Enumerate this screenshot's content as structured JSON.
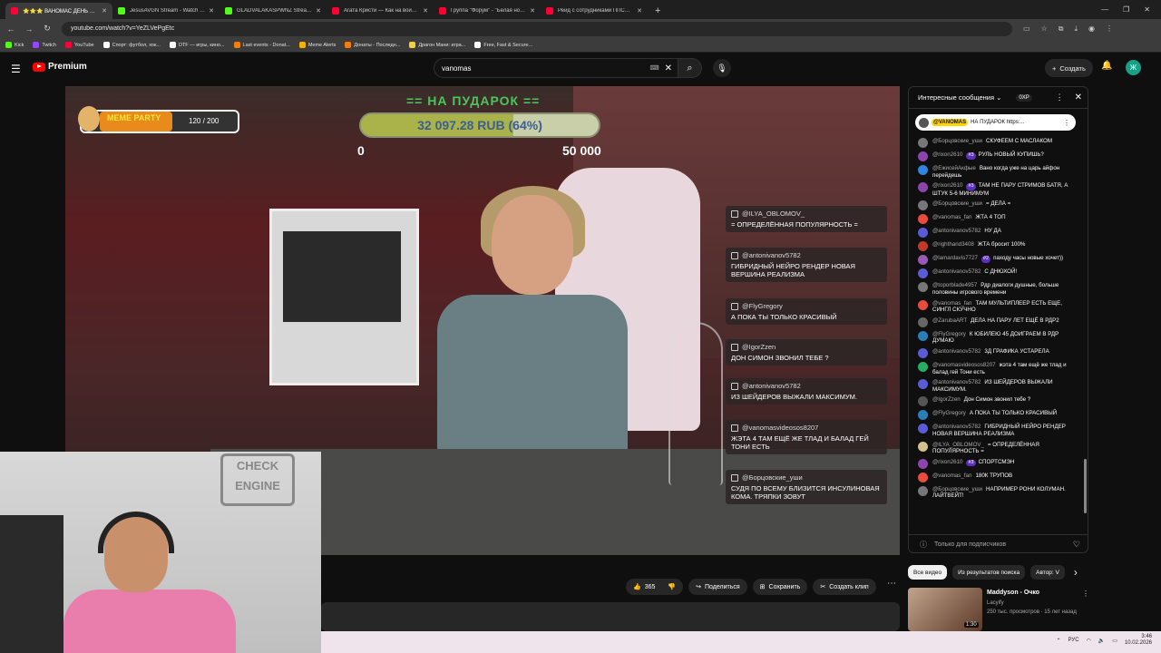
{
  "browser": {
    "tabs": [
      {
        "title": "⭐⭐⭐ ВАНОМАС ДЕНЬ РОЖ...",
        "fav": "#ff0033",
        "active": true
      },
      {
        "title": "JesusAVGN Stream - Watch Live...",
        "fav": "#53fc18",
        "active": false
      },
      {
        "title": "GLADVALAKASPWNZ Stream -...",
        "fav": "#53fc18",
        "active": false
      },
      {
        "title": "Агата Кристи — Как на войне...",
        "fav": "#ff0033",
        "active": false
      },
      {
        "title": "Группа \"Форум\" - \"Белая ночь\"...",
        "fav": "#ff0033",
        "active": false
      },
      {
        "title": "Рейд с сотрудниками ППСП У...",
        "fav": "#ff0033",
        "active": false
      }
    ],
    "url": "youtube.com/watch?v=YeZLVePgEtc",
    "bookmarks": [
      {
        "label": "Kick",
        "color": "#53fc18"
      },
      {
        "label": "Twitch",
        "color": "#9146ff"
      },
      {
        "label": "YouTube",
        "color": "#ff0033"
      },
      {
        "label": "Спорт: футбол, хок...",
        "color": "#ffffff"
      },
      {
        "label": "DTF — игры, кино...",
        "color": "#ffffff"
      },
      {
        "label": "Last events - Donat...",
        "color": "#f57d07"
      },
      {
        "label": "Meme Alerts",
        "color": "#f4b400"
      },
      {
        "label": "Донаты - Последн...",
        "color": "#f57d07"
      },
      {
        "label": "Драгон Мани: игра...",
        "color": "#f4d03f"
      },
      {
        "label": "Free, Fast & Secure...",
        "color": "#ffffff"
      }
    ]
  },
  "youtube": {
    "brand": "Premium",
    "search_value": "vanomas",
    "create_label": "Создать",
    "avatar_letter": "Ж"
  },
  "overlay": {
    "goal_title": "== НА ПУДАРОК ==",
    "goal_text": "32 097.28 RUB (64%)",
    "goal_progress": 64,
    "goal_min": "0",
    "goal_max": "50 000",
    "meme_title": "MEME PARTY",
    "meme_count": "120 / 200"
  },
  "overlay_chat": [
    {
      "name": "@ILYA_OBLOMOV_",
      "text": "= ОПРЕДЕЛЁННАЯ ПОПУЛЯРНОСТЬ ="
    },
    {
      "name": "@antonivanov5782",
      "text": "ГИБРИДНЫЙ НЕЙРО РЕНДЕР НОВАЯ ВЕРШИНА РЕАЛИЗМА"
    },
    {
      "name": "@FlyGregory",
      "text": "А ПОКА ТЫ ТОЛЬКО КРАСИВЫЙ"
    },
    {
      "name": "@IgorZzen",
      "text": "Дон Симон звонил тебе ?"
    },
    {
      "name": "@antonivanov5782",
      "text": "ИЗ ШЕЙДЕРОВ ВЫЖАЛИ МАКСИМУМ."
    },
    {
      "name": "@vanomasvideosos8207",
      "text": "жэта 4 там ещё же тлад и балад гей Тони есть"
    },
    {
      "name": "@Борцовские_уши",
      "text": "СУДЯ ПО ВСЕМУ БЛИЗИТСЯ ИНСУЛИНОВАЯ КОМА. ТРЯПКИ ЗОВУТ"
    }
  ],
  "actions": {
    "like_count": "365",
    "share": "Поделиться",
    "save": "Сохранить",
    "clip": "Создать клип"
  },
  "chat": {
    "header": "Интересные сообщения",
    "xp": "0XP",
    "pinned_name": "@VANOMAS",
    "pinned_text": "НА ПУДАРОК https:...",
    "input_placeholder": "Только для подписчиков",
    "messages": [
      {
        "author": "@Борцовские_уши",
        "badge": "",
        "text": "СКУФЕЕМ С МАСЛАКОМ",
        "color": "#777"
      },
      {
        "author": "@rixon2610",
        "badge": "#3",
        "text": "РУЛЬ НОВЫЙ КУПИШЬ?",
        "color": "#8e44ad"
      },
      {
        "author": "@ЕжисейАкфые",
        "badge": "",
        "text": "Вано когда уже на царь айфон перейдешь",
        "color": "#2e86de"
      },
      {
        "author": "@rixon2610",
        "badge": "#3",
        "text": "ТАМ НЕ ПАРУ СТРИМОВ БАТЯ, А ШТУК 5-6 МИНИМУМ",
        "color": "#8e44ad"
      },
      {
        "author": "@Борцовские_уши",
        "badge": "",
        "text": "= ДЕЛА =",
        "color": "#777"
      },
      {
        "author": "@vanomas_fan",
        "badge": "",
        "text": "ЖТА 4 ТОП",
        "color": "#e74c3c"
      },
      {
        "author": "@antonivanov5782",
        "badge": "",
        "text": "НУ ДА",
        "color": "#5b5bd6"
      },
      {
        "author": "@righthand3408",
        "badge": "",
        "text": "ЖТА бросит 100%",
        "color": "#c0392b"
      },
      {
        "author": "@lamardavis7727",
        "badge": "#2",
        "text": "паходу часы новые хочет))",
        "color": "#9b59b6"
      },
      {
        "author": "@antonivanov5782",
        "badge": "",
        "text": "С ДНЮХОЙ!",
        "color": "#5b5bd6"
      },
      {
        "author": "@toporblade4957",
        "badge": "",
        "text": "Рдр диалоги душные, больше половины игрового времени",
        "color": "#777"
      },
      {
        "author": "@vanomas_fan",
        "badge": "",
        "text": "ТАМ МУЛЬТИПЛЕЕР ЕСТЬ ЕЩЕ, СИНГЛ СКУЧНО",
        "color": "#e74c3c"
      },
      {
        "author": "@ZarubaART",
        "badge": "",
        "text": "ДЕЛА НА ПАРУ ЛЕТ ЕЩЁ В РДР2",
        "color": "#666"
      },
      {
        "author": "@FlyGregory",
        "badge": "",
        "text": "К ЮБИЛЕЮ 45 ДОИГРАЕМ В РДР ДУМАЮ",
        "color": "#2980b9"
      },
      {
        "author": "@antonivanov5782",
        "badge": "",
        "text": "3Д ГРАФИКА УСТАРЕЛА",
        "color": "#5b5bd6"
      },
      {
        "author": "@vanomasvideosos8207",
        "badge": "",
        "text": "жэта 4 там ещё же тлад и балад гей Тони есть",
        "color": "#27ae60"
      },
      {
        "author": "@antonivanov5782",
        "badge": "",
        "text": "ИЗ ШЕЙДЕРОВ ВЫЖАЛИ МАКСИМУМ.",
        "color": "#5b5bd6"
      },
      {
        "author": "@IgorZzen",
        "badge": "",
        "text": "Дон Симон звонил тебе ?",
        "color": "#555"
      },
      {
        "author": "@FlyGregory",
        "badge": "",
        "text": "А ПОКА ТЫ ТОЛЬКО КРАСИВЫЙ",
        "color": "#2980b9"
      },
      {
        "author": "@antonivanov5782",
        "badge": "",
        "text": "ГИБРИДНЫЙ НЕЙРО РЕНДЕР НОВАЯ ВЕРШИНА РЕАЛИЗМА",
        "color": "#5b5bd6"
      },
      {
        "author": "@ILYA_OBLOMOV_",
        "badge": "",
        "text": "= ОПРЕДЕЛЁННАЯ ПОПУЛЯРНОСТЬ =",
        "color": "#d4c08a"
      },
      {
        "author": "@rixon2610",
        "badge": "#3",
        "text": "СПОРТСМЭН",
        "color": "#8e44ad"
      },
      {
        "author": "@vanomas_fan",
        "badge": "",
        "text": "180К ТРУПОВ",
        "color": "#e74c3c"
      },
      {
        "author": "@Борцовские_уши",
        "badge": "",
        "text": "НАПРИМЕР РОНИ КОЛУМАН. ЛАЙТВЕЙТ!",
        "color": "#777"
      }
    ]
  },
  "chips": [
    "Все видео",
    "Из результатов поиска",
    "Автор: V"
  ],
  "recommendation": {
    "title": "Maddyson - Очко",
    "channel": "Lacyify",
    "meta": "250 тыс. просмотров · 15 лет назад",
    "duration": "1:30"
  },
  "webcam": {
    "sign": "CHECK ENGINE"
  },
  "tray": {
    "lang": "РУС",
    "time": "3:46",
    "date": "10.02.2026"
  }
}
